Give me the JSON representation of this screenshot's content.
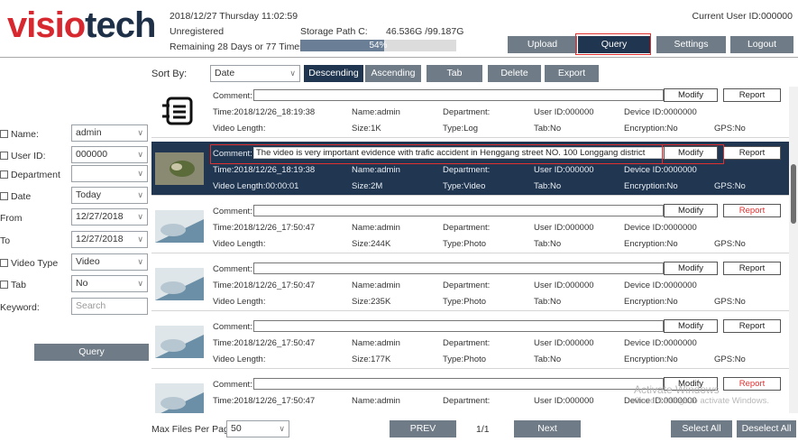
{
  "header": {
    "logo_part1": "visio",
    "logo_part2": "tech",
    "datetime": "2018/12/27 Thursday 11:02:59",
    "status": "Unregistered",
    "remaining": "Remaining 28 Days or 77 Times",
    "storage_label": "Storage Path C:",
    "storage_value": "46.536G /99.187G",
    "storage_percent_label": "54%",
    "storage_fraction": 0.54,
    "current_user": "Current User ID:000000",
    "buttons": {
      "upload": "Upload",
      "query": "Query",
      "settings": "Settings",
      "logout": "Logout"
    }
  },
  "sortbar": {
    "label": "Sort By:",
    "selected": "Date",
    "buttons": {
      "descending": "Descending",
      "ascending": "Ascending",
      "tab": "Tab",
      "delete": "Delete",
      "export": "Export"
    }
  },
  "filters": {
    "name": {
      "label": "Name:",
      "value": "admin"
    },
    "user_id": {
      "label": "User ID:",
      "value": "000000"
    },
    "department": {
      "label": "Department",
      "value": ""
    },
    "date": {
      "label": "Date",
      "value": "Today"
    },
    "from": {
      "label": "From",
      "value": "12/27/2018"
    },
    "to": {
      "label": "To",
      "value": "12/27/2018"
    },
    "video_type": {
      "label": "Video Type",
      "value": "Video"
    },
    "tab": {
      "label": "Tab",
      "value": "No"
    },
    "keyword": {
      "label": "Keyword:",
      "placeholder": "Search"
    },
    "query_button": "Query"
  },
  "records": [
    {
      "comment_label": "Comment:",
      "comment": "",
      "time": "Time:2018/12/26_18:19:38",
      "length": "Video Length:",
      "name": "Name:admin",
      "size": "Size:1K",
      "department": "Department:",
      "type": "Type:Log",
      "user_id": "User ID:000000",
      "tab": "Tab:No",
      "device": "Device ID:0000000",
      "encryption": "Encryption:No",
      "gps": "GPS:No",
      "modify": "Modify",
      "report": "Report",
      "report_red": false,
      "thumb": "log-icon"
    },
    {
      "comment_label": "Comment:",
      "comment": "The video is very important evidence with trafic accident in Henggang street NO. 100 Longgang district",
      "time": "Time:2018/12/26_18:19:38",
      "length": "Video Length:00:00:01",
      "name": "Name:admin",
      "size": "Size:2M",
      "department": "Department:",
      "type": "Type:Video",
      "user_id": "User ID:000000",
      "tab": "Tab:No",
      "device": "Device ID:0000000",
      "encryption": "Encryption:No",
      "gps": "GPS:No",
      "modify": "Modify",
      "report": "Report",
      "report_red": false,
      "thumb": "video"
    },
    {
      "comment_label": "Comment:",
      "comment": "",
      "time": "Time:2018/12/26_17:50:47",
      "length": "Video Length:",
      "name": "Name:admin",
      "size": "Size:244K",
      "department": "Department:",
      "type": "Type:Photo",
      "user_id": "User ID:000000",
      "tab": "Tab:No",
      "device": "Device ID:0000000",
      "encryption": "Encryption:No",
      "gps": "GPS:No",
      "modify": "Modify",
      "report": "Report",
      "report_red": true,
      "thumb": "photo"
    },
    {
      "comment_label": "Comment:",
      "comment": "",
      "time": "Time:2018/12/26_17:50:47",
      "length": "Video Length:",
      "name": "Name:admin",
      "size": "Size:235K",
      "department": "Department:",
      "type": "Type:Photo",
      "user_id": "User ID:000000",
      "tab": "Tab:No",
      "device": "Device ID:0000000",
      "encryption": "Encryption:No",
      "gps": "GPS:No",
      "modify": "Modify",
      "report": "Report",
      "report_red": false,
      "thumb": "photo"
    },
    {
      "comment_label": "Comment:",
      "comment": "",
      "time": "Time:2018/12/26_17:50:47",
      "length": "Video Length:",
      "name": "Name:admin",
      "size": "Size:177K",
      "department": "Department:",
      "type": "Type:Photo",
      "user_id": "User ID:000000",
      "tab": "Tab:No",
      "device": "Device ID:0000000",
      "encryption": "Encryption:No",
      "gps": "GPS:No",
      "modify": "Modify",
      "report": "Report",
      "report_red": false,
      "thumb": "photo"
    },
    {
      "comment_label": "Comment:",
      "comment": "",
      "time": "Time:2018/12/26_17:50:47",
      "length": "Video Length:",
      "name": "Name:admin",
      "size": "Size:1M",
      "department": "Department:",
      "type": "Type:Photo",
      "user_id": "User ID:000000",
      "tab": "Tab:No",
      "device": "Device ID:0000000",
      "encryption": "Encryption:No",
      "gps": "GPS:No",
      "modify": "Modify",
      "report": "Report",
      "report_red": true,
      "thumb": "photo"
    }
  ],
  "footer": {
    "max_files_label": "Max Files Per Page",
    "max_files_value": "50",
    "prev": "PREV",
    "page": "1/1",
    "next": "Next",
    "select_all": "Select All",
    "deselect_all": "Deselect All"
  },
  "watermark": {
    "line1": "Activate Windows",
    "line2": "Go to Settings to activate Windows."
  },
  "colors": {
    "accent_dark": "#20354f",
    "button_gray": "#6f7b86",
    "logo_red": "#d7282f",
    "logo_dark": "#1e3048",
    "highlight_red": "#e03030"
  }
}
